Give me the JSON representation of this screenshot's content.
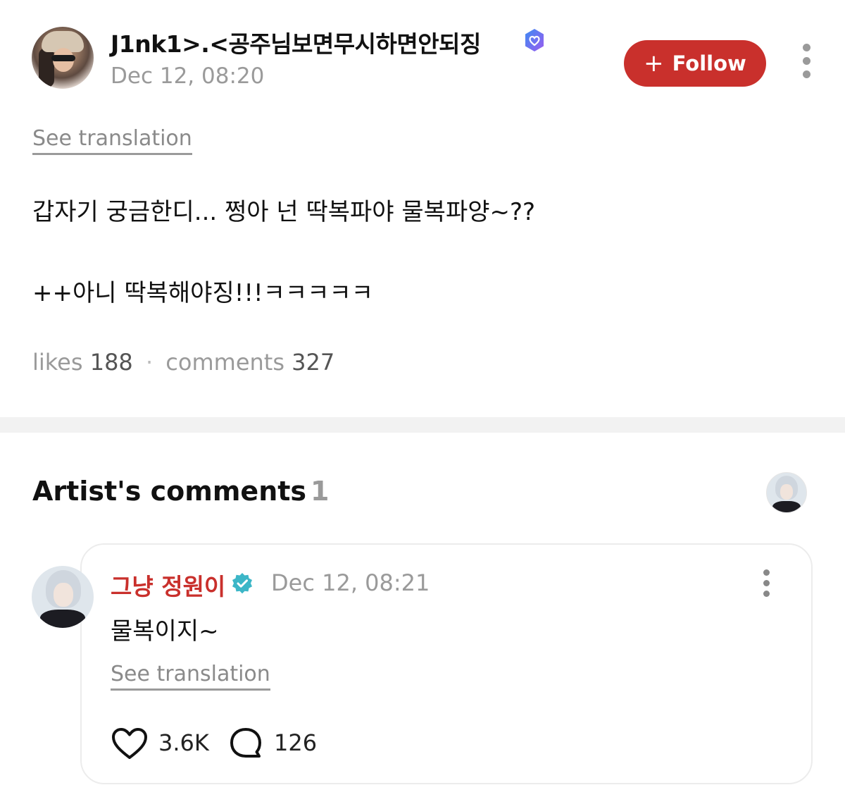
{
  "post": {
    "username": "J1nk1>.<공주님보면무시하면안되징",
    "date": "Dec 12, 08:20",
    "follow_label": "Follow",
    "follow_plus": "+",
    "see_translation": "See translation",
    "body_line1": "갑자기 궁금한디...  쩡아 넌 딱복파야 물복파양~??",
    "body_line2": "++아니 딱복해야징!!!ㅋㅋㅋㅋㅋ",
    "likes_label": "likes",
    "likes_count": "188",
    "separator": "·",
    "comments_label": "comments",
    "comments_count": "327"
  },
  "artist_section": {
    "title": "Artist's comments",
    "count": "1"
  },
  "artist_comment": {
    "name": "그냥 정원이",
    "date": "Dec 12, 08:21",
    "text": "물복이지~",
    "see_translation": "See translation",
    "likes": "3.6K",
    "replies": "126"
  },
  "colors": {
    "accent_red": "#c9302c",
    "muted_gray": "#9a9a9a",
    "verified_teal": "#3cb6c7",
    "verified_purple": "#6b5cf0"
  },
  "icons": {
    "verified_post": "verified-badge-icon",
    "verified_artist": "verified-check-icon",
    "more": "more-vertical-icon",
    "like": "heart-icon",
    "reply": "speech-bubble-icon"
  }
}
